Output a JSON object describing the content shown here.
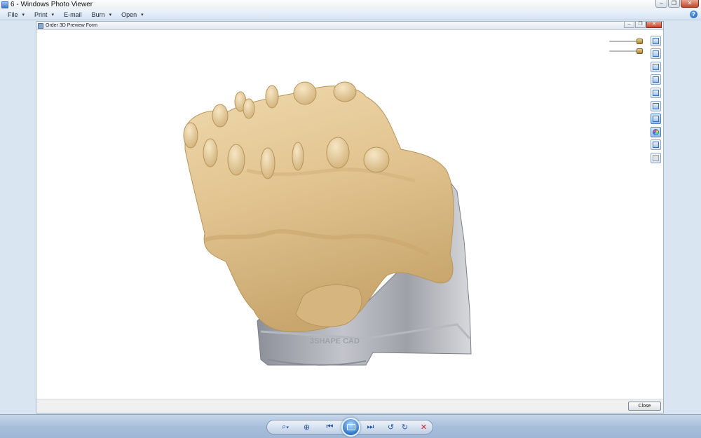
{
  "window": {
    "title": "6 - Windows Photo Viewer",
    "controls": {
      "minimize": "–",
      "maximize": "❐",
      "close": "✕"
    }
  },
  "menu": [
    {
      "label": "File",
      "dropdown": true
    },
    {
      "label": "Print",
      "dropdown": true
    },
    {
      "label": "E-mail",
      "dropdown": false
    },
    {
      "label": "Burn",
      "dropdown": true
    },
    {
      "label": "Open",
      "dropdown": true
    }
  ],
  "help_label": "?",
  "dialog": {
    "title": "Order 3D Preview Form",
    "close_label": "Close",
    "controls": {
      "minimize": "–",
      "maximize": "❐",
      "close": "✕"
    },
    "model_engraving": "3SHAPE CAD"
  },
  "right_toolbar": {
    "tools": [
      {
        "icon": "view-front-icon",
        "active": false,
        "enabled": true
      },
      {
        "icon": "view-back-icon",
        "active": false,
        "enabled": true
      },
      {
        "icon": "view-left-icon",
        "active": false,
        "enabled": true
      },
      {
        "icon": "view-right-icon",
        "active": false,
        "enabled": true
      },
      {
        "icon": "view-top-icon",
        "active": false,
        "enabled": true
      },
      {
        "icon": "view-bottom-icon",
        "active": false,
        "enabled": true
      },
      {
        "icon": "model-toggle-icon",
        "active": true,
        "enabled": true
      },
      {
        "icon": "color-toggle-icon",
        "active": true,
        "enabled": true
      },
      {
        "icon": "scan-toggle-icon",
        "active": false,
        "enabled": true
      },
      {
        "icon": "texture-toggle-icon",
        "active": false,
        "enabled": false
      }
    ]
  },
  "sliders": [
    {
      "icon": "model-opacity-icon",
      "value": 1.0
    },
    {
      "icon": "antagonist-opacity-icon",
      "value": 1.0
    }
  ],
  "bottom_toolbar": {
    "zoom_caret": "▾",
    "buttons": [
      "zoom-icon",
      "actual-size-icon",
      "previous-icon",
      "slideshow-icon",
      "next-icon",
      "rotate-counterclockwise-icon",
      "rotate-clockwise-icon",
      "delete-icon"
    ],
    "glyphs": {
      "zoom": "⌕",
      "fit": "⊕",
      "prev": "⏮",
      "next": "⏭",
      "rotate_ccw": "↺",
      "rotate_cw": "↻",
      "delete": "✕"
    }
  },
  "colors": {
    "model": "#e5c99a",
    "base": "#a9acb3",
    "accent": "#2f75c8"
  }
}
